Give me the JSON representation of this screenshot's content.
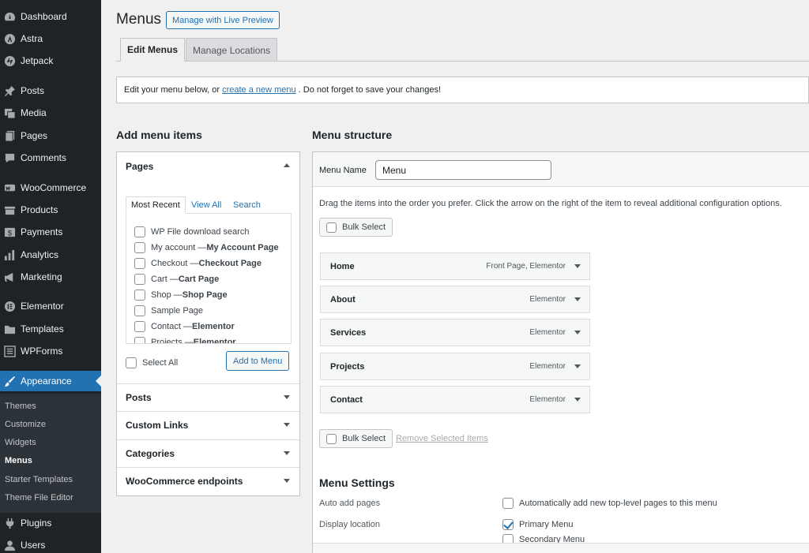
{
  "sidebar": {
    "items": [
      {
        "label": "Dashboard",
        "icon": "dashboard-icon"
      },
      {
        "label": "Astra",
        "icon": "astra-icon"
      },
      {
        "label": "Jetpack",
        "icon": "jetpack-icon"
      },
      {
        "label": "Posts",
        "icon": "pin-icon"
      },
      {
        "label": "Media",
        "icon": "media-icon"
      },
      {
        "label": "Pages",
        "icon": "pages-icon"
      },
      {
        "label": "Comments",
        "icon": "comments-icon"
      },
      {
        "label": "WooCommerce",
        "icon": "woocommerce-icon"
      },
      {
        "label": "Products",
        "icon": "products-icon"
      },
      {
        "label": "Payments",
        "icon": "payments-icon"
      },
      {
        "label": "Analytics",
        "icon": "analytics-icon"
      },
      {
        "label": "Marketing",
        "icon": "megaphone-icon"
      },
      {
        "label": "Elementor",
        "icon": "elementor-icon"
      },
      {
        "label": "Templates",
        "icon": "folder-icon"
      },
      {
        "label": "WPForms",
        "icon": "forms-icon"
      },
      {
        "label": "Appearance",
        "icon": "brush-icon"
      },
      {
        "label": "Plugins",
        "icon": "plug-icon"
      },
      {
        "label": "Users",
        "icon": "user-icon"
      }
    ],
    "submenu": [
      "Themes",
      "Customize",
      "Widgets",
      "Menus",
      "Starter Templates",
      "Theme File Editor"
    ],
    "active_color": "#2271b1"
  },
  "header": {
    "title": "Menus",
    "live_preview": "Manage with Live Preview",
    "tabs": [
      "Edit Menus",
      "Manage Locations"
    ]
  },
  "notice": {
    "before": "Edit your menu below, or",
    "link": "create a new menu",
    "after": ". Do not forget to save your changes!"
  },
  "add_items": {
    "heading": "Add menu items",
    "sections": [
      "Pages",
      "Posts",
      "Custom Links",
      "Categories",
      "WooCommerce endpoints"
    ],
    "page_tabs": [
      "Most Recent",
      "View All",
      "Search"
    ],
    "pages": [
      {
        "text": "WP File download search",
        "bold": ""
      },
      {
        "text": "My account — ",
        "bold": "My Account Page"
      },
      {
        "text": "Checkout — ",
        "bold": "Checkout Page"
      },
      {
        "text": "Cart — ",
        "bold": "Cart Page"
      },
      {
        "text": "Shop — ",
        "bold": "Shop Page"
      },
      {
        "text": "Sample Page",
        "bold": ""
      },
      {
        "text": "Contact — ",
        "bold": "Elementor"
      },
      {
        "text": "Projects — ",
        "bold": "Elementor"
      }
    ],
    "select_all": "Select All",
    "add_button": "Add to Menu"
  },
  "structure": {
    "heading": "Menu structure",
    "menu_name_label": "Menu Name",
    "menu_name_value": "Menu",
    "instructions": "Drag the items into the order you prefer. Click the arrow on the right of the item to reveal additional configuration options.",
    "bulk_select": "Bulk Select",
    "remove_selected": "Remove Selected Items",
    "items": [
      {
        "title": "Home",
        "type": "Front Page, Elementor"
      },
      {
        "title": "About",
        "type": "Elementor"
      },
      {
        "title": "Services",
        "type": "Elementor"
      },
      {
        "title": "Projects",
        "type": "Elementor"
      },
      {
        "title": "Contact",
        "type": "Elementor"
      }
    ]
  },
  "settings": {
    "title": "Menu Settings",
    "auto_add_label": "Auto add pages",
    "auto_add_option": "Automatically add new top-level pages to this menu",
    "display_location_label": "Display location",
    "locations": [
      {
        "name": "Primary Menu",
        "checked": true
      },
      {
        "name": "Secondary Menu",
        "checked": false
      }
    ]
  }
}
